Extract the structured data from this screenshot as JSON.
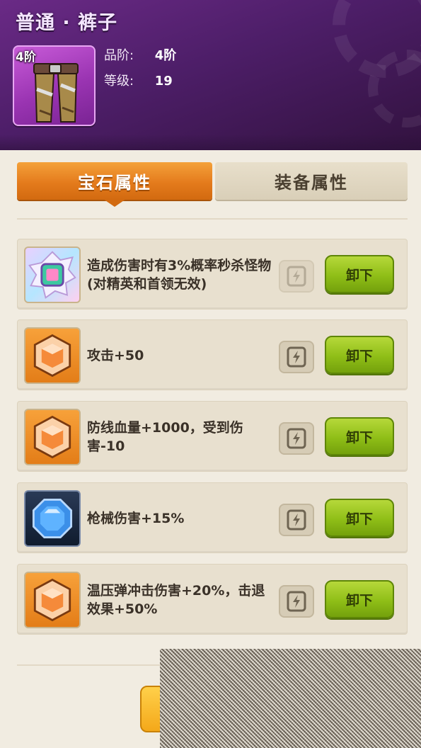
{
  "header": {
    "title": "普通 · 裤子",
    "tier_badge": "4阶",
    "stats": [
      {
        "label": "品阶:",
        "value": "4阶"
      },
      {
        "label": "等级:",
        "value": "19"
      }
    ]
  },
  "tabs": [
    {
      "label": "宝石属性",
      "active": true
    },
    {
      "label": "装备属性",
      "active": false
    }
  ],
  "gems": [
    {
      "icon": "rainbow-gem-icon",
      "description": "造成伤害时有3%概率秒杀怪物(对精英和首领无效)",
      "button_label": "卸下",
      "lock_dimmed": true
    },
    {
      "icon": "orange-gem-icon",
      "description": "攻击+50",
      "button_label": "卸下",
      "lock_dimmed": false
    },
    {
      "icon": "orange-gem-icon",
      "description": "防线血量+1000，受到伤害-10",
      "button_label": "卸下",
      "lock_dimmed": false
    },
    {
      "icon": "blue-gem-icon",
      "description": "枪械伤害+15%",
      "button_label": "卸下",
      "lock_dimmed": false
    },
    {
      "icon": "orange-gem-icon",
      "description": "温压弹冲击伤害+20%，击退效果+50%",
      "button_label": "卸下",
      "lock_dimmed": false
    }
  ],
  "colors": {
    "header_bg": "#4d1e68",
    "tab_active": "#e47b1c",
    "tab_inactive": "#d9cfb8",
    "unload_button": "#8fbe17",
    "page_bg": "#f1ece1"
  }
}
